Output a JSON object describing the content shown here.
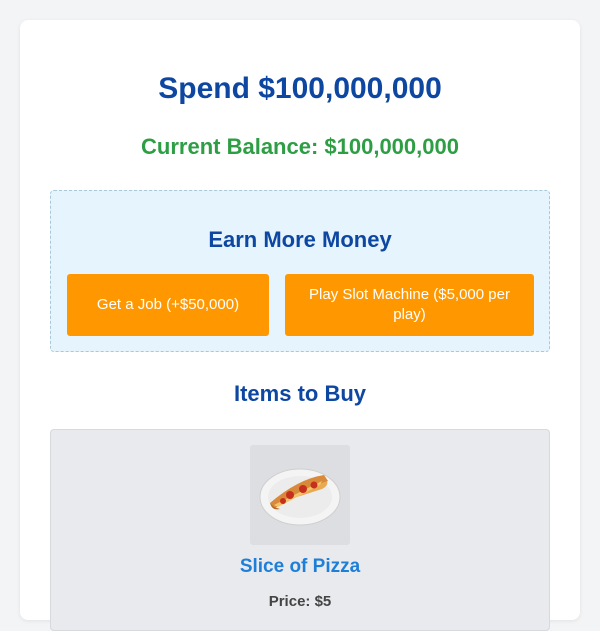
{
  "header": {
    "title": "Spend $100,000,000",
    "balance": "Current Balance: $100,000,000"
  },
  "earn": {
    "title": "Earn More Money",
    "job_button": "Get a Job (+$50,000)",
    "slot_button": "Play Slot Machine ($5,000 per play)"
  },
  "items_section": {
    "title": "Items to Buy",
    "items": [
      {
        "name": "Slice of Pizza",
        "price": "Price: $5",
        "image_icon": "pizza-slice-image"
      }
    ]
  },
  "colors": {
    "title": "#0d47a1",
    "balance": "#2e9e45",
    "button": "#ff9800",
    "item_name": "#1e7fd8",
    "earn_panel_bg": "#e6f5fd"
  }
}
